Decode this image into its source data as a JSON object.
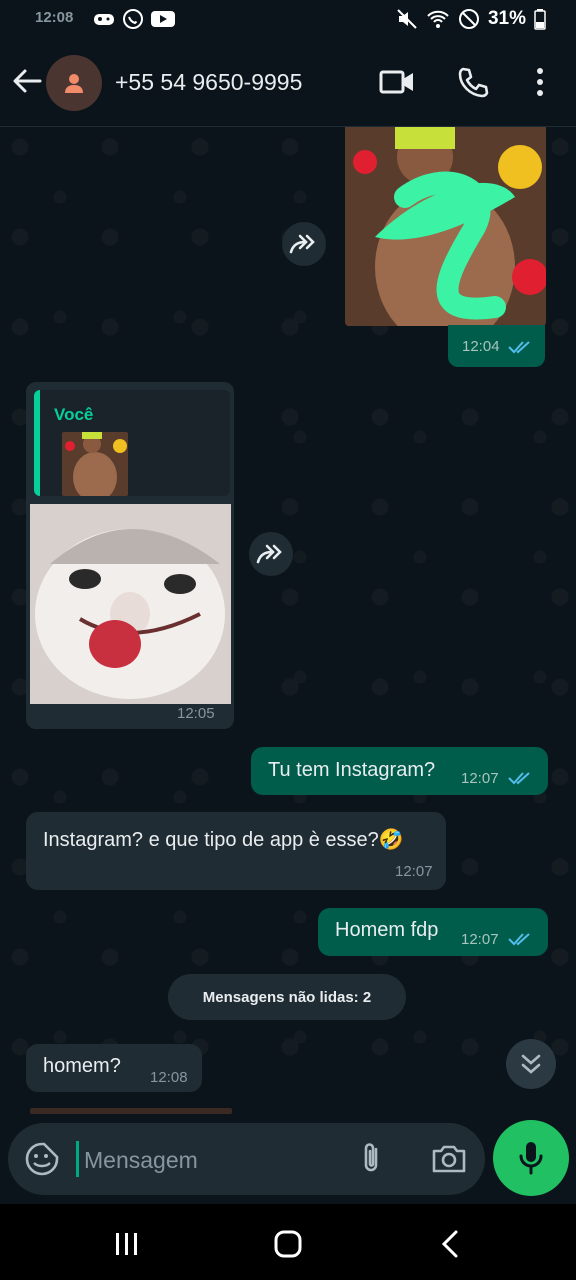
{
  "status": {
    "time": "12:08",
    "battery": "31%"
  },
  "header": {
    "contact": "+55 54 9650-9995"
  },
  "messages": {
    "photo_time": "12:04",
    "reply_name": "Você",
    "lizard_time": "12:05",
    "m1_text": "Tu tem Instagram?",
    "m1_time": "12:07",
    "m2_text": "Instagram? e que tipo de app è esse?🤣",
    "m2_time": "12:07",
    "m3_text": "Homem fdp",
    "m3_time": "12:07",
    "unread": "Mensagens não lidas: 2",
    "m4_text": "homem?",
    "m4_time": "12:08"
  },
  "input": {
    "placeholder": "Mensagem"
  },
  "colors": {
    "accent": "#00a884",
    "outgoing": "#005c4b",
    "incoming": "#202c33",
    "mic": "#21c063"
  }
}
